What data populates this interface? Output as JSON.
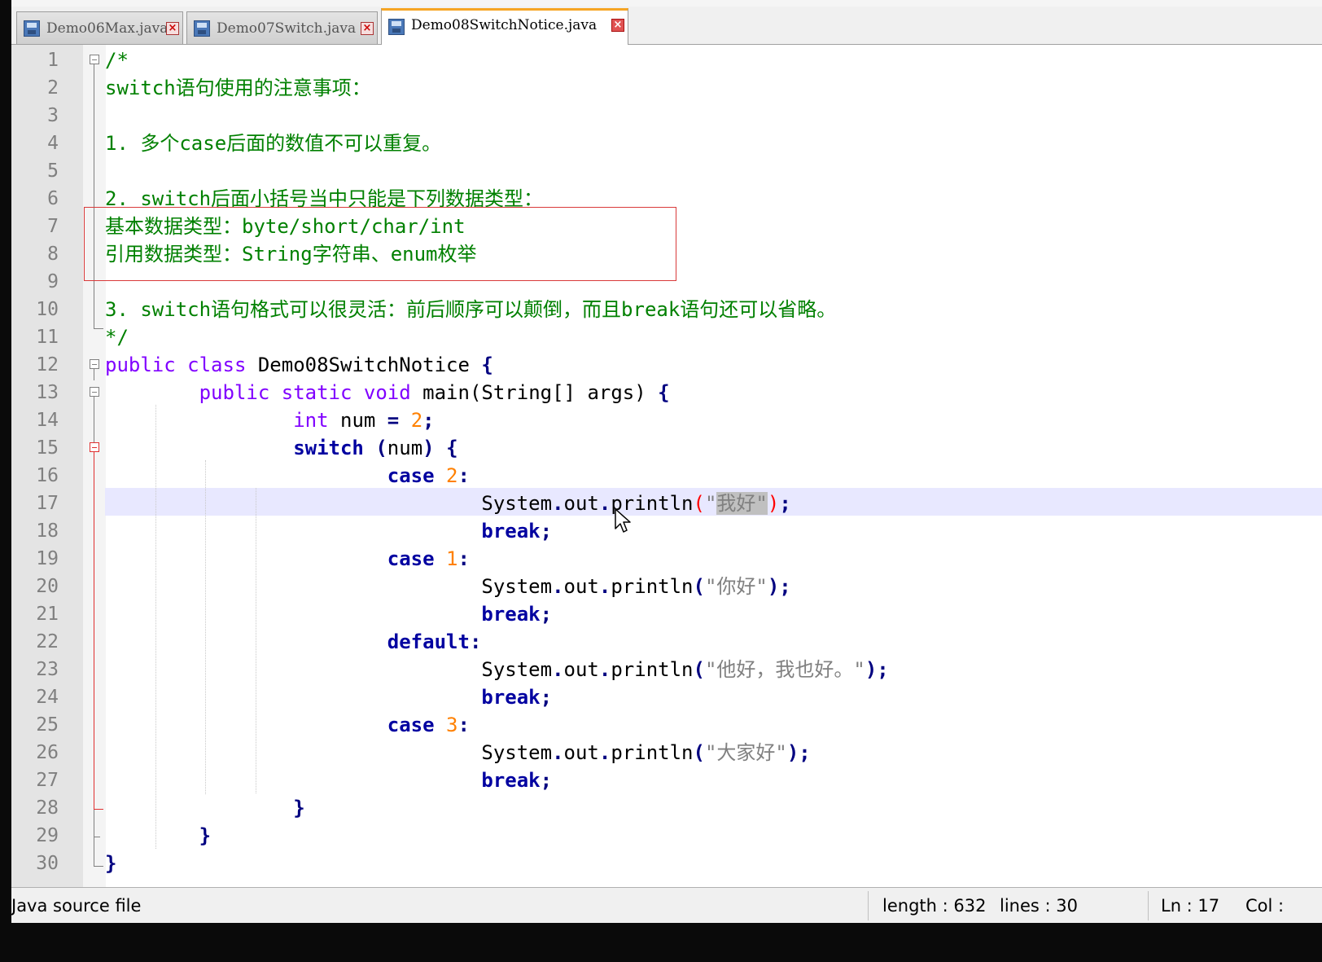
{
  "tabs": [
    {
      "label": "Demo06Max.java",
      "active": false
    },
    {
      "label": "Demo07Switch.java",
      "active": false
    },
    {
      "label": "Demo08SwitchNotice.java",
      "active": true
    }
  ],
  "editor": {
    "current_line": 17,
    "lines": [
      {
        "num": "1",
        "tokens": [
          {
            "t": "/*",
            "c": "cm"
          }
        ]
      },
      {
        "num": "2",
        "tokens": [
          {
            "t": "switch语句使用的注意事项：",
            "c": "cm"
          }
        ]
      },
      {
        "num": "3",
        "tokens": []
      },
      {
        "num": "4",
        "tokens": [
          {
            "t": "1. 多个case后面的数值不可以重复。",
            "c": "cm"
          }
        ]
      },
      {
        "num": "5",
        "tokens": []
      },
      {
        "num": "6",
        "tokens": [
          {
            "t": "2. switch后面小括号当中只能是下列数据类型：",
            "c": "cm"
          }
        ]
      },
      {
        "num": "7",
        "tokens": [
          {
            "t": "基本数据类型：byte/short/char/int",
            "c": "cm"
          }
        ]
      },
      {
        "num": "8",
        "tokens": [
          {
            "t": "引用数据类型：String字符串、enum枚举",
            "c": "cm"
          }
        ]
      },
      {
        "num": "9",
        "tokens": []
      },
      {
        "num": "10",
        "tokens": [
          {
            "t": "3. switch语句格式可以很灵活：前后顺序可以颠倒，而且break语句还可以省略。",
            "c": "cm"
          }
        ]
      },
      {
        "num": "11",
        "tokens": [
          {
            "t": "*/",
            "c": "cm"
          }
        ]
      },
      {
        "num": "12",
        "tokens": [
          {
            "t": "public",
            "c": "kw"
          },
          {
            "t": " ",
            "c": "pl"
          },
          {
            "t": "class",
            "c": "kw"
          },
          {
            "t": " Demo08SwitchNotice ",
            "c": "pl"
          },
          {
            "t": "{",
            "c": "op"
          }
        ]
      },
      {
        "num": "13",
        "tokens": [
          {
            "t": "        ",
            "c": "pl"
          },
          {
            "t": "public",
            "c": "kw"
          },
          {
            "t": " ",
            "c": "pl"
          },
          {
            "t": "static",
            "c": "kw"
          },
          {
            "t": " ",
            "c": "pl"
          },
          {
            "t": "void",
            "c": "kw"
          },
          {
            "t": " main(String[] args) ",
            "c": "pl"
          },
          {
            "t": "{",
            "c": "op"
          }
        ]
      },
      {
        "num": "14",
        "tokens": [
          {
            "t": "                ",
            "c": "pl"
          },
          {
            "t": "int",
            "c": "ty"
          },
          {
            "t": " num ",
            "c": "pl"
          },
          {
            "t": "=",
            "c": "op"
          },
          {
            "t": " ",
            "c": "pl"
          },
          {
            "t": "2",
            "c": "nm"
          },
          {
            "t": ";",
            "c": "op"
          }
        ]
      },
      {
        "num": "15",
        "tokens": [
          {
            "t": "                ",
            "c": "pl"
          },
          {
            "t": "switch",
            "c": "kb"
          },
          {
            "t": " ",
            "c": "pl"
          },
          {
            "t": "(",
            "c": "op"
          },
          {
            "t": "num",
            "c": "pl"
          },
          {
            "t": ")",
            "c": "op"
          },
          {
            "t": " ",
            "c": "pl"
          },
          {
            "t": "{",
            "c": "op"
          }
        ]
      },
      {
        "num": "16",
        "tokens": [
          {
            "t": "                        ",
            "c": "pl"
          },
          {
            "t": "case",
            "c": "kb"
          },
          {
            "t": " ",
            "c": "pl"
          },
          {
            "t": "2",
            "c": "nm"
          },
          {
            "t": ":",
            "c": "op"
          }
        ]
      },
      {
        "num": "17",
        "tokens": [
          {
            "t": "                                System",
            "c": "pl"
          },
          {
            "t": ".",
            "c": "op"
          },
          {
            "t": "out",
            "c": "pl"
          },
          {
            "t": ".",
            "c": "op"
          },
          {
            "t": "println",
            "c": "pl"
          },
          {
            "t": "(",
            "c": "br"
          },
          {
            "t": "\"",
            "c": "st"
          },
          {
            "t": "我好\"",
            "c": "st sel"
          },
          {
            "t": ")",
            "c": "br"
          },
          {
            "t": ";",
            "c": "op"
          }
        ]
      },
      {
        "num": "18",
        "tokens": [
          {
            "t": "                                ",
            "c": "pl"
          },
          {
            "t": "break",
            "c": "kb"
          },
          {
            "t": ";",
            "c": "op"
          }
        ]
      },
      {
        "num": "19",
        "tokens": [
          {
            "t": "                        ",
            "c": "pl"
          },
          {
            "t": "case",
            "c": "kb"
          },
          {
            "t": " ",
            "c": "pl"
          },
          {
            "t": "1",
            "c": "nm"
          },
          {
            "t": ":",
            "c": "op"
          }
        ]
      },
      {
        "num": "20",
        "tokens": [
          {
            "t": "                                System",
            "c": "pl"
          },
          {
            "t": ".",
            "c": "op"
          },
          {
            "t": "out",
            "c": "pl"
          },
          {
            "t": ".",
            "c": "op"
          },
          {
            "t": "println",
            "c": "pl"
          },
          {
            "t": "(",
            "c": "op"
          },
          {
            "t": "\"你好\"",
            "c": "st"
          },
          {
            "t": ");",
            "c": "op"
          }
        ]
      },
      {
        "num": "21",
        "tokens": [
          {
            "t": "                                ",
            "c": "pl"
          },
          {
            "t": "break",
            "c": "kb"
          },
          {
            "t": ";",
            "c": "op"
          }
        ]
      },
      {
        "num": "22",
        "tokens": [
          {
            "t": "                        ",
            "c": "pl"
          },
          {
            "t": "default",
            "c": "kb"
          },
          {
            "t": ":",
            "c": "op"
          }
        ]
      },
      {
        "num": "23",
        "tokens": [
          {
            "t": "                                System",
            "c": "pl"
          },
          {
            "t": ".",
            "c": "op"
          },
          {
            "t": "out",
            "c": "pl"
          },
          {
            "t": ".",
            "c": "op"
          },
          {
            "t": "println",
            "c": "pl"
          },
          {
            "t": "(",
            "c": "op"
          },
          {
            "t": "\"他好，我也好。\"",
            "c": "st"
          },
          {
            "t": ");",
            "c": "op"
          }
        ]
      },
      {
        "num": "24",
        "tokens": [
          {
            "t": "                                ",
            "c": "pl"
          },
          {
            "t": "break",
            "c": "kb"
          },
          {
            "t": ";",
            "c": "op"
          }
        ]
      },
      {
        "num": "25",
        "tokens": [
          {
            "t": "                        ",
            "c": "pl"
          },
          {
            "t": "case",
            "c": "kb"
          },
          {
            "t": " ",
            "c": "pl"
          },
          {
            "t": "3",
            "c": "nm"
          },
          {
            "t": ":",
            "c": "op"
          }
        ]
      },
      {
        "num": "26",
        "tokens": [
          {
            "t": "                                System",
            "c": "pl"
          },
          {
            "t": ".",
            "c": "op"
          },
          {
            "t": "out",
            "c": "pl"
          },
          {
            "t": ".",
            "c": "op"
          },
          {
            "t": "println",
            "c": "pl"
          },
          {
            "t": "(",
            "c": "op"
          },
          {
            "t": "\"大家好\"",
            "c": "st"
          },
          {
            "t": ");",
            "c": "op"
          }
        ]
      },
      {
        "num": "27",
        "tokens": [
          {
            "t": "                                ",
            "c": "pl"
          },
          {
            "t": "break",
            "c": "kb"
          },
          {
            "t": ";",
            "c": "op"
          }
        ]
      },
      {
        "num": "28",
        "tokens": [
          {
            "t": "                ",
            "c": "pl"
          },
          {
            "t": "}",
            "c": "op"
          }
        ]
      },
      {
        "num": "29",
        "tokens": [
          {
            "t": "        ",
            "c": "pl"
          },
          {
            "t": "}",
            "c": "op"
          }
        ]
      },
      {
        "num": "30",
        "tokens": [
          {
            "t": "}",
            "c": "op"
          }
        ]
      }
    ]
  },
  "statusbar": {
    "file_type": "Java source file",
    "length": "length : 632",
    "lines": "lines : 30",
    "ln": "Ln : 17",
    "col": "Col :"
  },
  "colors": {
    "comment": "#008000",
    "keyword": "#8000ff",
    "bold_keyword": "#0000a0",
    "number": "#ff8000",
    "string": "#808080",
    "current_line_bg": "#e8e8ff",
    "annotation_box": "#d93a3a",
    "active_tab_accent": "#f6a524"
  },
  "icons": {
    "tab_file": "floppy-disk-icon",
    "tab_close": "close-icon",
    "fold_marker": "fold-minus-icon",
    "pointer": "mouse-pointer-icon"
  }
}
